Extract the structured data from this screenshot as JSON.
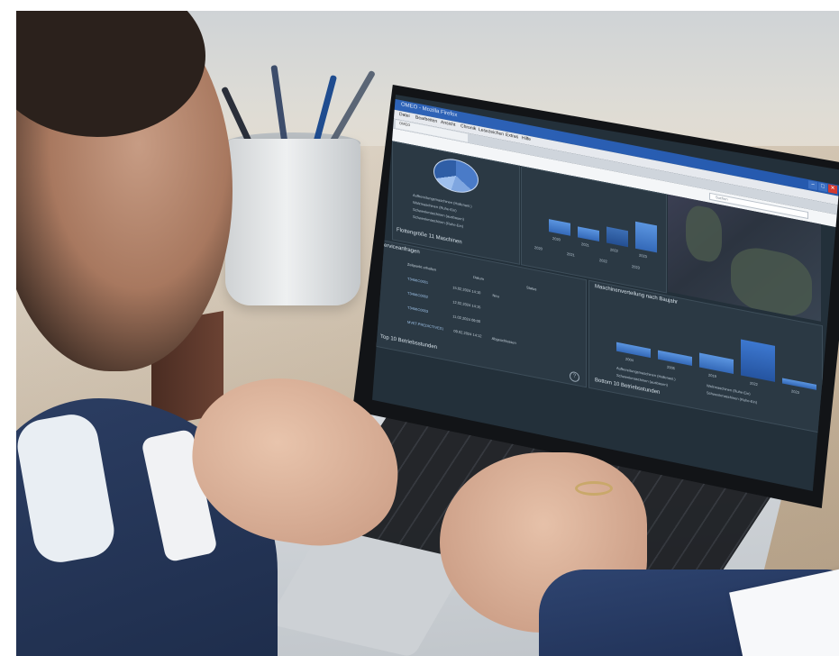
{
  "browser": {
    "window_title": "OMEO - Mozilla Firefox",
    "menu": [
      "Datei",
      "Bearbeiten",
      "Ansicht",
      "Chronik",
      "Lesezeichen",
      "Extras",
      "Hilfe"
    ],
    "tab_label": "OMEO",
    "search_placeholder": "Suchen",
    "window_buttons": [
      "–",
      "□",
      "✕"
    ]
  },
  "dashboard": {
    "panel_fleet_title": "Flottengröße 11 Maschinen",
    "fleet_legend": [
      "Aufbereitungsmaschinen (Hallenanl.)",
      "Walzmaschinen (Ruhe-Ein)",
      "Schwenkmaschinen (ausbauen)",
      "Schwenkmaschinen (Ruhe-Ein)"
    ],
    "bar_chart_top_years": [
      "2020",
      "2021",
      "2022",
      "2023"
    ],
    "bar_chart_top_legend": [
      "2020",
      "2021",
      "2022",
      "2023"
    ],
    "panel_service_title": "Serviceanfragen",
    "service_columns": [
      "Zeitpunkt erhalten",
      "Datum",
      "Status"
    ],
    "service_rows": [
      {
        "id": "T34MIC0001",
        "date": "15.02.2024 14:10",
        "status": "Neu"
      },
      {
        "id": "T34MIC0002",
        "date": "12.02.2024 14:15",
        "status": ""
      },
      {
        "id": "T34MIC0003",
        "date": "11.02.2024 09:00",
        "status": ""
      },
      {
        "id": "MVET.PREDICTIVE01",
        "date": "09.02.2024 14:12",
        "status": "Abgeschlossen"
      }
    ],
    "panel_distribution_title": "Maschinenverteilung nach Baujahr",
    "distribution_years": [
      "2004",
      "2006",
      "2019",
      "2022",
      "2023"
    ],
    "distribution_legend": [
      "Aufbereitungsmaschinen (Hallenanl.)",
      "Walzmaschinen (Ruhe-Ein)",
      "Schwenkmaschinen (ausbauen)",
      "Schwenkmaschinen (Ruhe-Ein)"
    ],
    "panel_top10_left": "Top 10 Betriebsstunden",
    "panel_top10_right": "Bottom 10 Betriebsstunden",
    "help_glyph": "?"
  }
}
